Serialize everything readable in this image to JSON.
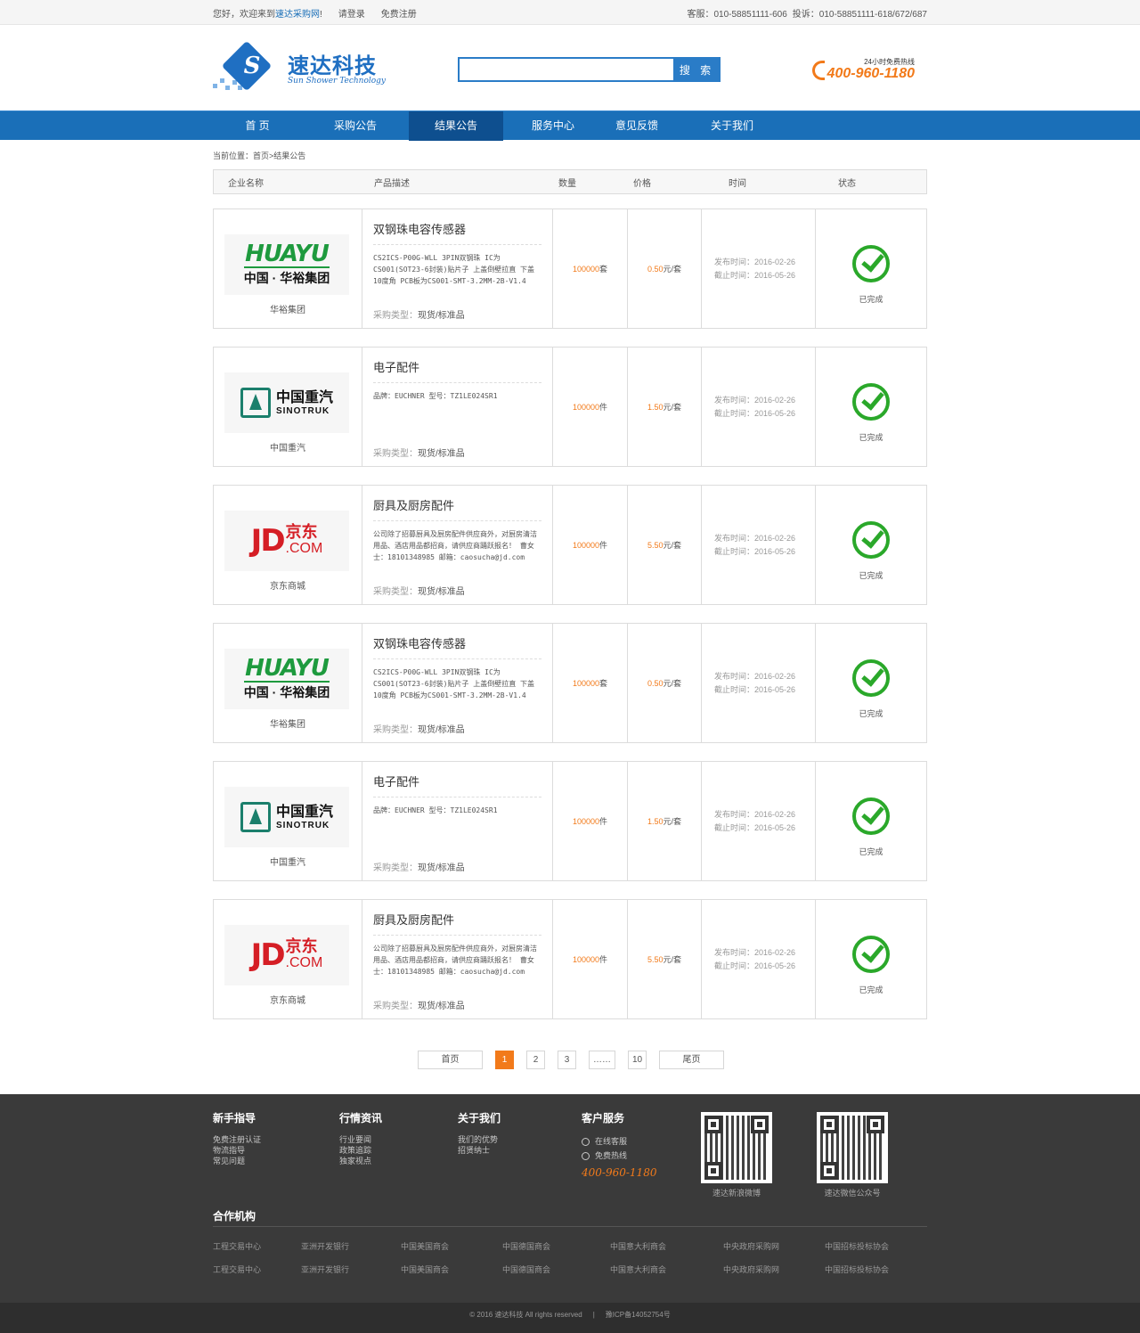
{
  "topbar": {
    "welcome_prefix": "您好，欢迎来到",
    "site_name": "速达采购网",
    "welcome_suffix": "!",
    "login": "请登录",
    "register": "免费注册",
    "service_phone": "客服：010-58851111-606",
    "complaint_phone": "投诉：010-58851111-618/672/687"
  },
  "header": {
    "logo_letter": "S",
    "logo_name": "速达科技",
    "logo_en": "Sun Shower Technology",
    "search_placeholder": "",
    "search_button": "搜 索",
    "hotline_tag": "24小时免费热线",
    "hotline_number": "400-960-1180"
  },
  "nav": {
    "items": [
      {
        "label": "首 页"
      },
      {
        "label": "采购公告"
      },
      {
        "label": "结果公告"
      },
      {
        "label": "服务中心"
      },
      {
        "label": "意见反馈"
      },
      {
        "label": "关于我们"
      }
    ],
    "active_index": 2
  },
  "breadcrumb": "当前位置：首页>结果公告",
  "table": {
    "headers": [
      "企业名称",
      "产品描述",
      "数量",
      "价格",
      "时间",
      "状态"
    ]
  },
  "rows": [
    {
      "logo": "huayu",
      "logo_top": "HUAYU",
      "logo_bottom": "中国 · 华裕集团",
      "company": "华裕集团",
      "product": "双钢珠电容传感器",
      "detail": "CS2ICS-P00G-WLL 3PIN双钢珠 IC为CS001(SOT23-6封装)贴片子 上盖倒壁拉直 下盖10度角 PCB板为CS001-SMT-3.2MM-2B-V1.4",
      "type_label": "采购类型：",
      "type_value": "现货/标准品",
      "qty": "100000",
      "qty_unit": "套",
      "price": "0.50",
      "price_unit": "元/套",
      "publish": "发布时间：2016-02-26",
      "deadline": "截止时间：2016-05-26",
      "status": "已完成"
    },
    {
      "logo": "sino",
      "logo_cn": "中国重汽",
      "logo_en": "SINOTRUK",
      "company": "中国重汽",
      "product": "电子配件",
      "detail": "品牌：EUCHNER 型号：TZ1LE024SR1",
      "type_label": "采购类型：",
      "type_value": "现货/标准品",
      "qty": "100000",
      "qty_unit": "件",
      "price": "1.50",
      "price_unit": "元/套",
      "publish": "发布时间：2016-02-26",
      "deadline": "截止时间：2016-05-26",
      "status": "已完成"
    },
    {
      "logo": "jd",
      "logo_jd": "JD",
      "logo_cn": "京东",
      "logo_com": ".COM",
      "company": "京东商城",
      "product": "厨具及厨房配件",
      "detail": "公司除了招募厨具及厨房配件供应商外，对厨房清洁用品、酒店用品都招商，请供应商踊跃报名！ 曹女士：18101348985 邮箱：caosucha@jd.com",
      "type_label": "采购类型：",
      "type_value": "现货/标准品",
      "qty": "100000",
      "qty_unit": "件",
      "price": "5.50",
      "price_unit": "元/套",
      "publish": "发布时间：2016-02-26",
      "deadline": "截止时间：2016-05-26",
      "status": "已完成"
    },
    {
      "logo": "huayu",
      "logo_top": "HUAYU",
      "logo_bottom": "中国 · 华裕集团",
      "company": "华裕集团",
      "product": "双钢珠电容传感器",
      "detail": "CS2ICS-P00G-WLL 3PIN双钢珠 IC为CS001(SOT23-6封装)贴片子 上盖倒壁拉直 下盖10度角 PCB板为CS001-SMT-3.2MM-2B-V1.4",
      "type_label": "采购类型：",
      "type_value": "现货/标准品",
      "qty": "100000",
      "qty_unit": "套",
      "price": "0.50",
      "price_unit": "元/套",
      "publish": "发布时间：2016-02-26",
      "deadline": "截止时间：2016-05-26",
      "status": "已完成"
    },
    {
      "logo": "sino",
      "logo_cn": "中国重汽",
      "logo_en": "SINOTRUK",
      "company": "中国重汽",
      "product": "电子配件",
      "detail": "品牌：EUCHNER 型号：TZ1LE024SR1",
      "type_label": "采购类型：",
      "type_value": "现货/标准品",
      "qty": "100000",
      "qty_unit": "件",
      "price": "1.50",
      "price_unit": "元/套",
      "publish": "发布时间：2016-02-26",
      "deadline": "截止时间：2016-05-26",
      "status": "已完成"
    },
    {
      "logo": "jd",
      "logo_jd": "JD",
      "logo_cn": "京东",
      "logo_com": ".COM",
      "company": "京东商城",
      "product": "厨具及厨房配件",
      "detail": "公司除了招募厨具及厨房配件供应商外，对厨房清洁用品、酒店用品都招商，请供应商踊跃报名！ 曹女士：18101348985 邮箱：caosucha@jd.com",
      "type_label": "采购类型：",
      "type_value": "现货/标准品",
      "qty": "100000",
      "qty_unit": "件",
      "price": "5.50",
      "price_unit": "元/套",
      "publish": "发布时间：2016-02-26",
      "deadline": "截止时间：2016-05-26",
      "status": "已完成"
    }
  ],
  "pager": {
    "first": "首页",
    "pages": [
      "1",
      "2",
      "3",
      "……",
      "10"
    ],
    "current": "1",
    "last": "尾页"
  },
  "footer": {
    "cols": [
      {
        "title": "新手指导",
        "links": [
          "免费注册认证",
          "物流指导",
          "常见问题"
        ]
      },
      {
        "title": "行情资讯",
        "links": [
          "行业要闻",
          "政策追踪",
          "独家视点"
        ]
      },
      {
        "title": "关于我们",
        "links": [
          "我们的优势",
          "招贤纳士"
        ]
      }
    ],
    "service": {
      "title": "客户服务",
      "online": "在线客服",
      "hotline_label": "免费热线",
      "hotline": "400-960-1180"
    },
    "qr": [
      {
        "caption": "速达新浪微博"
      },
      {
        "caption": "速达微信公众号"
      }
    ],
    "partners_title": "合作机构",
    "partners": [
      [
        "工程交易中心",
        "亚洲开发银行",
        "中国美国商会",
        "中国德国商会",
        "中国意大利商会",
        "中央政府采购网",
        "中国招标投标协会"
      ],
      [
        "工程交易中心",
        "亚洲开发银行",
        "中国美国商会",
        "中国德国商会",
        "中国意大利商会",
        "中央政府采购网",
        "中国招标投标协会"
      ]
    ],
    "copyright": "© 2016 速达科技 All rights reserved",
    "icp": "豫ICP备14052754号"
  },
  "colors": {
    "brand_blue": "#1a6fb8",
    "accent_orange": "#f27a1a",
    "status_green": "#2aa82a"
  }
}
